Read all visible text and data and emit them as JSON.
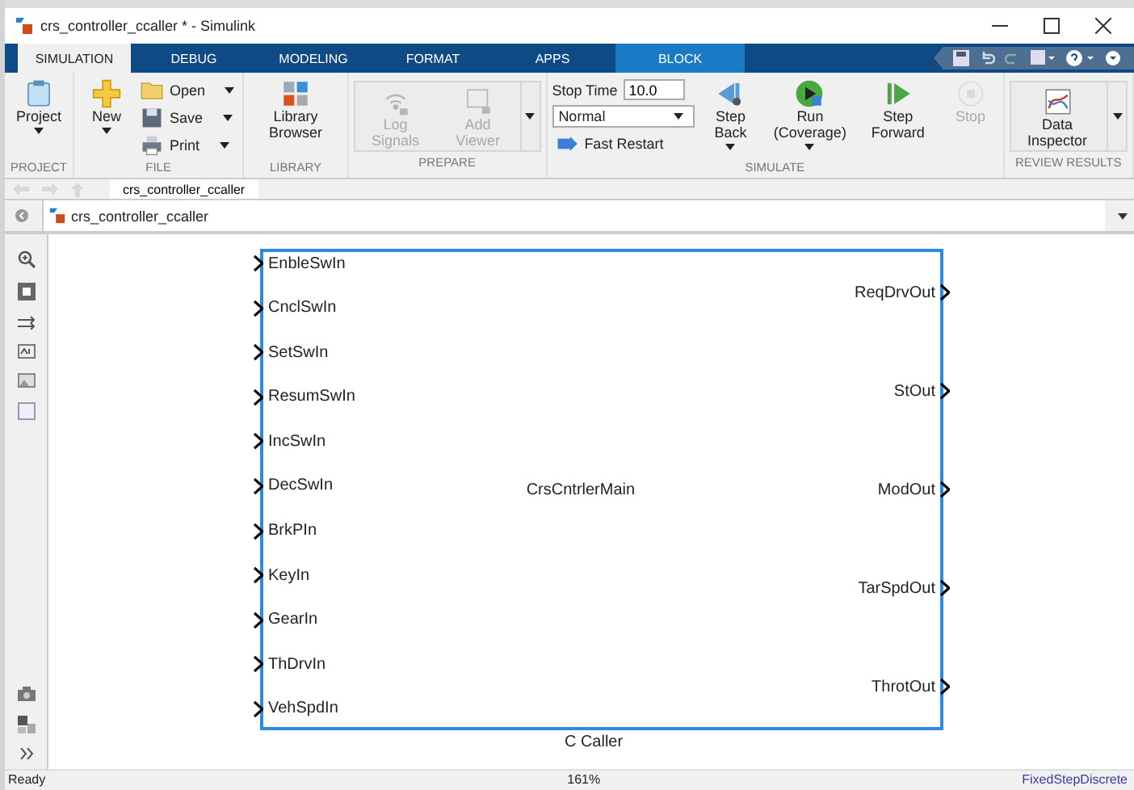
{
  "window": {
    "title": "crs_controller_ccaller * - Simulink"
  },
  "tabs": [
    {
      "label": "SIMULATION",
      "selected": true
    },
    {
      "label": "DEBUG",
      "selected": false
    },
    {
      "label": "MODELING",
      "selected": false
    },
    {
      "label": "FORMAT",
      "selected": false
    },
    {
      "label": "APPS",
      "selected": false
    },
    {
      "label": "BLOCK",
      "selected": false,
      "contextual": true
    }
  ],
  "ribbon": {
    "groups": [
      {
        "label": "PROJECT",
        "items": [
          {
            "kind": "large",
            "label": "Project",
            "dropdown": true,
            "disabled": false
          }
        ]
      },
      {
        "label": "FILE",
        "items": [
          {
            "kind": "large",
            "label": "New",
            "dropdown": true,
            "disabled": false
          },
          {
            "kind": "column",
            "items": [
              {
                "kind": "small",
                "label": "Open",
                "dropdown": true
              },
              {
                "kind": "small",
                "label": "Save",
                "dropdown": true
              },
              {
                "kind": "small",
                "label": "Print",
                "dropdown": true
              }
            ]
          }
        ]
      },
      {
        "label": "LIBRARY",
        "items": [
          {
            "kind": "large",
            "label": "Library Browser",
            "dropdown": false,
            "disabled": false
          }
        ]
      },
      {
        "label": "PREPARE",
        "gallery": true,
        "items": [
          {
            "kind": "large",
            "label": "Log Signals",
            "dropdown": false,
            "disabled": true
          },
          {
            "kind": "large",
            "label": "Add Viewer",
            "dropdown": false,
            "disabled": true
          }
        ]
      },
      {
        "label": "SIMULATE",
        "items": [
          {
            "kind": "column",
            "items": [
              {
                "kind": "field",
                "label": "Stop Time",
                "value": "10.0"
              },
              {
                "kind": "select",
                "value": "Normal"
              },
              {
                "kind": "small",
                "label": "Fast Restart",
                "dropdown": false
              }
            ]
          },
          {
            "kind": "large",
            "label": "Step Back",
            "dropdown": true,
            "disabled": false
          },
          {
            "kind": "large",
            "label": "Run (Coverage)",
            "dropdown": true,
            "disabled": false
          },
          {
            "kind": "large",
            "label": "Step Forward",
            "dropdown": false,
            "disabled": false
          },
          {
            "kind": "large",
            "label": "Stop",
            "dropdown": false,
            "disabled": true
          }
        ]
      },
      {
        "label": "REVIEW RESULTS",
        "gallery": true,
        "items": [
          {
            "kind": "large",
            "label": "Data Inspector",
            "dropdown": false,
            "disabled": false
          }
        ]
      }
    ]
  },
  "breadcrumb_tab": "crs_controller_ccaller",
  "address": "crs_controller_ccaller",
  "block": {
    "name": "CrsCntrlerMain",
    "caption": "C Caller",
    "selected": true,
    "inputs": [
      "EnbleSwIn",
      "CnclSwIn",
      "SetSwIn",
      "ResumSwIn",
      "IncSwIn",
      "DecSwIn",
      "BrkPIn",
      "KeyIn",
      "GearIn",
      "ThDrvIn",
      "VehSpdIn"
    ],
    "outputs": [
      "ReqDrvOut",
      "StOut",
      "ModOut",
      "TarSpdOut",
      "ThrotOut"
    ]
  },
  "status_bar": {
    "state": "Ready",
    "zoom": "161%",
    "solver": "FixedStepDiscrete"
  }
}
